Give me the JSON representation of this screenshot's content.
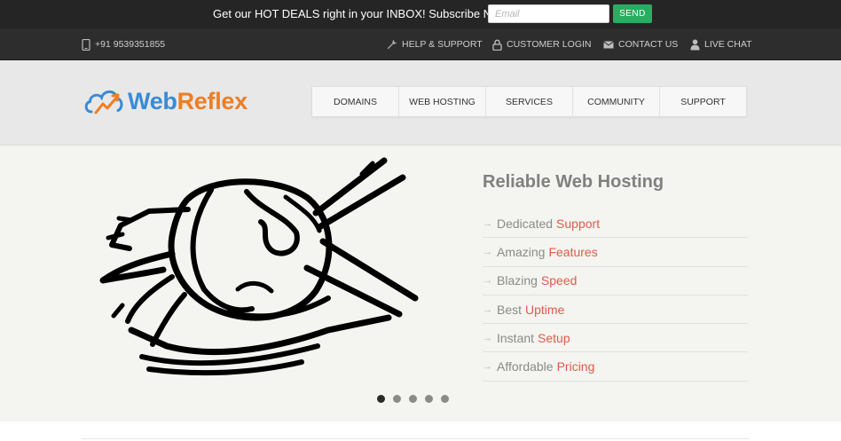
{
  "topbar": {
    "promo_text": "Get our HOT DEALS right in your INBOX! Subscribe NOW",
    "email_placeholder": "Email",
    "email_value": "",
    "send_label": "SEND",
    "send_color": "#27ae60"
  },
  "infobar": {
    "phone": "+91 9539351855",
    "links": [
      {
        "label": "HELP & SUPPORT",
        "icon": "wrench-icon"
      },
      {
        "label": "CUSTOMER LOGIN",
        "icon": "lock-icon"
      },
      {
        "label": "CONTACT US",
        "icon": "envelope-icon"
      },
      {
        "label": "LIVE CHAT",
        "icon": "user-icon"
      }
    ]
  },
  "logo": {
    "part1": "Web",
    "part2": "Reflex",
    "part1_color": "#3a8ad8",
    "part2_color": "#f07d22"
  },
  "nav": {
    "items": [
      "DOMAINS",
      "WEB HOSTING",
      "SERVICES",
      "COMMUNITY",
      "SUPPORT"
    ]
  },
  "hero": {
    "title": "Reliable Web Hosting",
    "features": [
      {
        "normal": "Dedicated",
        "accent": "Support"
      },
      {
        "normal": "Amazing",
        "accent": "Features"
      },
      {
        "normal": "Blazing",
        "accent": "Speed"
      },
      {
        "normal": "Best",
        "accent": "Uptime"
      },
      {
        "normal": "Instant",
        "accent": "Setup"
      },
      {
        "normal": "Affordable",
        "accent": "Pricing"
      }
    ],
    "accent_color": "#e05b4b",
    "slide_count": 5,
    "active_slide": 1
  }
}
